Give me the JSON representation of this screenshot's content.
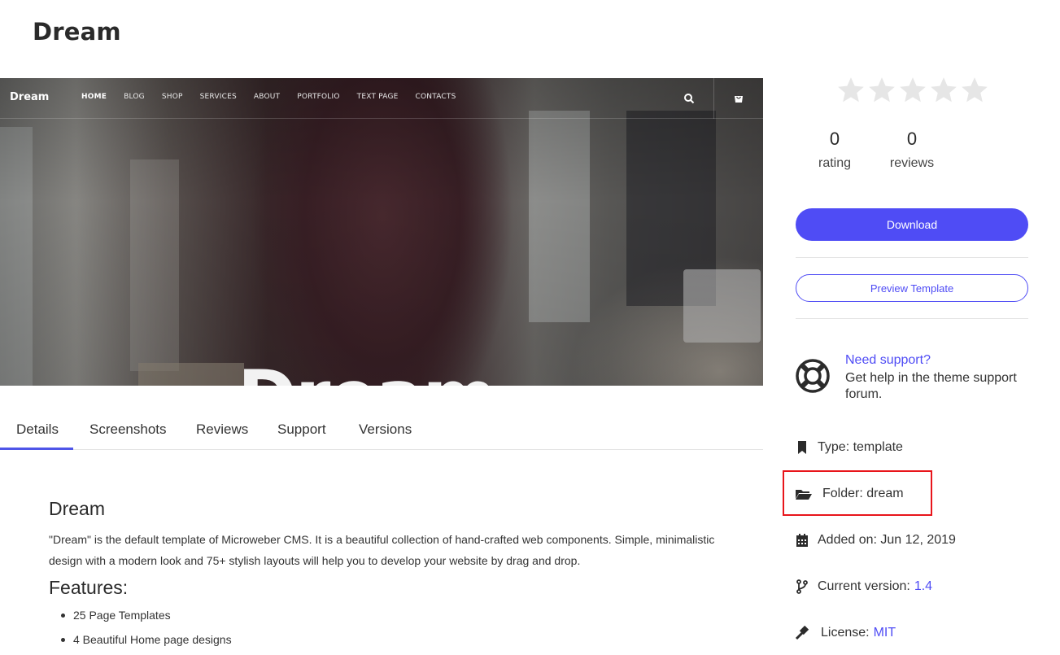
{
  "page": {
    "title": "Dream"
  },
  "hero": {
    "logo": "Dream",
    "menu": [
      "HOME",
      "BLOG",
      "SHOP",
      "SERVICES",
      "ABOUT",
      "PORTFOLIO",
      "TEXT PAGE",
      "CONTACTS"
    ],
    "headline": "Dream."
  },
  "tabs": [
    "Details",
    "Screenshots",
    "Reviews",
    "Support",
    "Versions"
  ],
  "active_tab": "Details",
  "details": {
    "title": "Dream",
    "description": "\"Dream\" is the default template of Microweber CMS. It is a beautiful collection of hand-crafted web components. Simple, minimalistic design with a modern look and 75+ stylish layouts will help you to develop your website by drag and drop.",
    "features_title": "Features:",
    "features": [
      "25 Page Templates",
      "4 Beautiful Home page designs"
    ]
  },
  "sidebar": {
    "stars": {
      "filled": 0,
      "total": 5,
      "empty_color": "#e6e6e6"
    },
    "rating": {
      "value": "0",
      "label": "rating"
    },
    "reviews": {
      "value": "0",
      "label": "reviews"
    },
    "download_label": "Download",
    "preview_label": "Preview Template",
    "support": {
      "link": "Need support?",
      "text": "Get help in the theme support forum."
    },
    "meta": {
      "type": "Type: template",
      "folder": "Folder: dream",
      "added": "Added on: Jun 12, 2019",
      "version_label": "Current version:",
      "version_value": "1.4",
      "license_label": "License:",
      "license_value": "MIT"
    }
  },
  "colors": {
    "accent": "#4f4cf5",
    "highlight": "#e8151b"
  }
}
